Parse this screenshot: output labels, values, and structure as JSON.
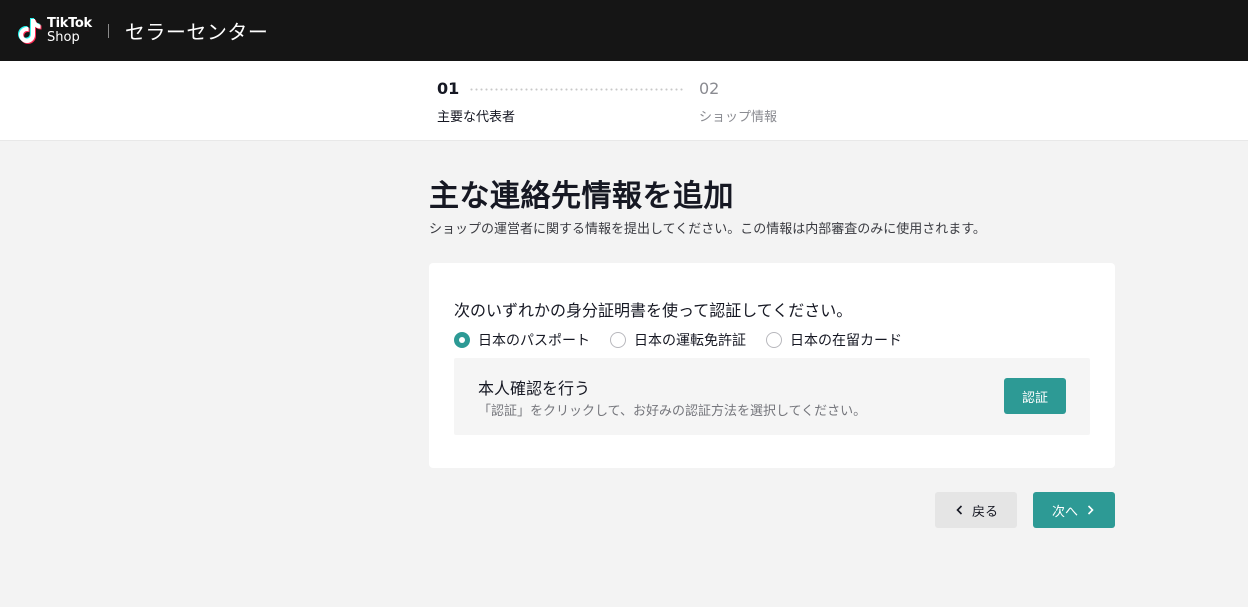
{
  "header": {
    "logo_line1": "TikTok",
    "logo_line2": "Shop",
    "app_title": "セラーセンター"
  },
  "stepper": {
    "steps": [
      {
        "number": "01",
        "label": "主要な代表者",
        "active": true
      },
      {
        "number": "02",
        "label": "ショップ情報",
        "active": false
      }
    ]
  },
  "main": {
    "title": "主な連絡先情報を追加",
    "subtitle": "ショップの運営者に関する情報を提出してください。この情報は内部審査のみに使用されます。"
  },
  "id_card": {
    "prompt": "次のいずれかの身分証明書を使って認証してください。",
    "options": [
      {
        "label": "日本のパスポート",
        "selected": true
      },
      {
        "label": "日本の運転免許証",
        "selected": false
      },
      {
        "label": "日本の在留カード",
        "selected": false
      }
    ],
    "verify": {
      "title": "本人確認を行う",
      "description": "「認証」をクリックして、お好みの認証方法を選択してください。",
      "button_label": "認証"
    }
  },
  "footer": {
    "back_label": "戻る",
    "next_label": "次へ"
  },
  "colors": {
    "accent": "#2d9a95",
    "header_bg": "#151515",
    "page_bg": "#f3f3f3"
  }
}
